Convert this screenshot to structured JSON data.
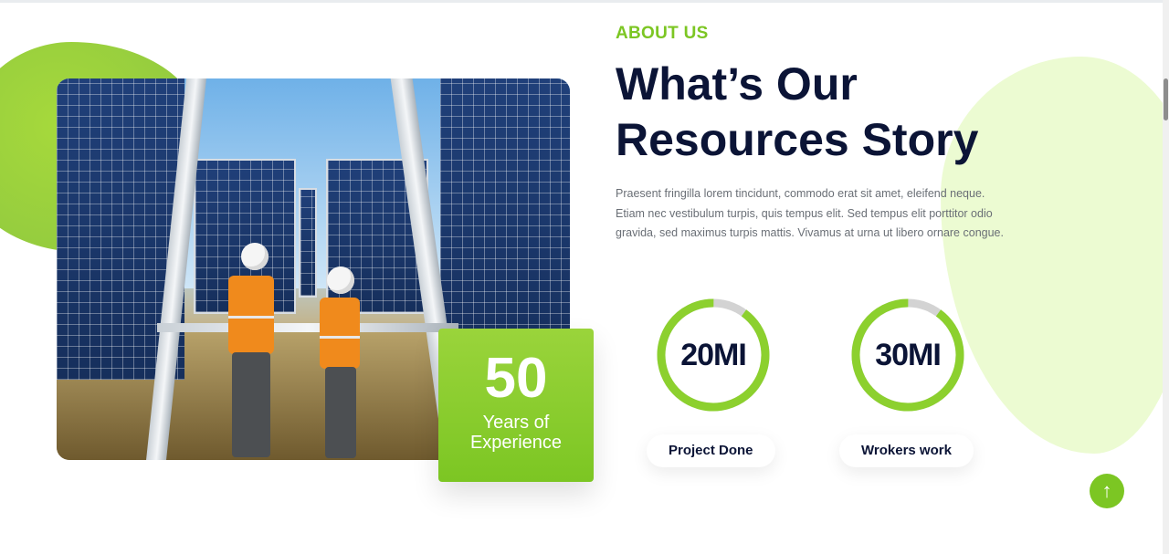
{
  "about": {
    "eyebrow": "ABOUT US",
    "title_line1": "What’s Our",
    "title_line2": "Resources Story",
    "paragraph": "Praesent fringilla lorem tincidunt, commodo erat sit amet, eleifend neque. Etiam nec vestibulum turpis, quis tempus elit. Sed tempus elit porttitor odio gravida, sed maximus turpis mattis. Vivamus at urna ut libero ornare congue."
  },
  "experience": {
    "number": "50",
    "label_line1": "Years of",
    "label_line2": "Experience"
  },
  "stats": [
    {
      "value": "20MI",
      "label": "Project Done",
      "progress": 0.9
    },
    {
      "value": "30MI",
      "label": "Wrokers work",
      "progress": 0.9
    }
  ],
  "colors": {
    "accent": "#7cc623",
    "heading": "#0b1436",
    "text": "#6a6f76",
    "blob_light": "#ecfbd2"
  },
  "icons": {
    "scroll_top": "arrow-up-icon"
  }
}
